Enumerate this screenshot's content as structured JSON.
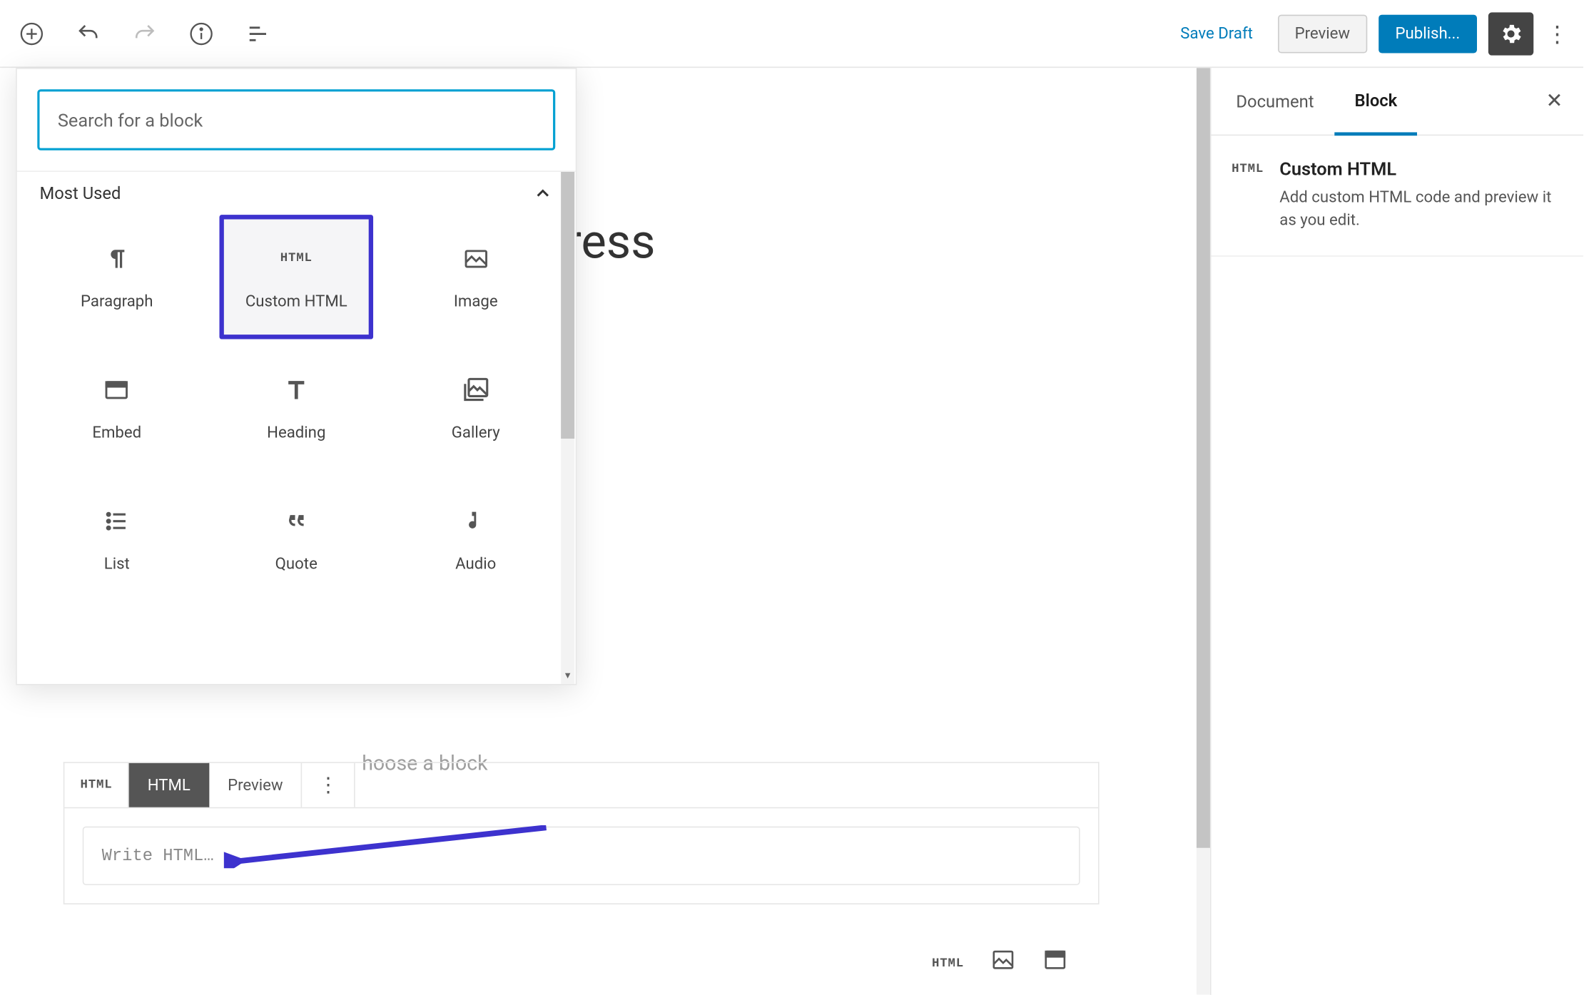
{
  "toolbar": {
    "save_draft": "Save Draft",
    "preview": "Preview",
    "publish": "Publish..."
  },
  "inserter": {
    "search_placeholder": "Search for a block",
    "section": "Most Used",
    "blocks": {
      "paragraph": "Paragraph",
      "custom_html": "Custom HTML",
      "image": "Image",
      "embed": "Embed",
      "heading": "Heading",
      "gallery": "Gallery",
      "list": "List",
      "quote": "Quote",
      "audio": "Audio"
    }
  },
  "canvas": {
    "title_fragment": "ress",
    "choose_text": "hoose a block",
    "html_badge": "HTML",
    "tab_html": "HTML",
    "tab_preview": "Preview",
    "write_placeholder": "Write HTML…"
  },
  "sidebar": {
    "tab_document": "Document",
    "tab_block": "Block",
    "panel_badge": "HTML",
    "panel_title": "Custom HTML",
    "panel_desc": "Add custom HTML code and preview it as you edit."
  }
}
